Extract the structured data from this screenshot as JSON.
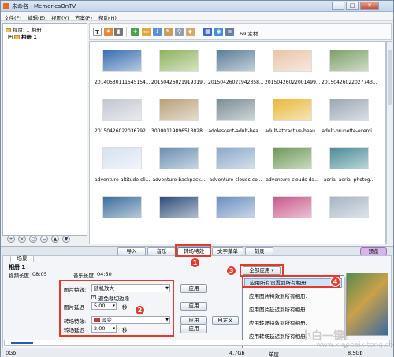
{
  "window": {
    "title": "未命名 - MemoriesOnTV",
    "controls": [
      "–",
      "□",
      "✕"
    ]
  },
  "menu": [
    "文件(F)",
    "编辑(E)",
    "视图(V)",
    "方案(P)",
    "帮助(H)"
  ],
  "tree": {
    "root": "视盘: 1 相册",
    "album": "相册 1"
  },
  "toolbar": {
    "count": "69 素材"
  },
  "photos": [
    {
      "name": "20140530111545154...",
      "color": "#3a6fb0"
    },
    {
      "name": "20150426021919319...",
      "color": "#8fb25e"
    },
    {
      "name": "20150426021942358...",
      "color": "#5c7e9a"
    },
    {
      "name": "20150426022001499...",
      "color": "#e9c4a8"
    },
    {
      "name": "20150426022027743...",
      "color": "#7ea06a"
    },
    {
      "name": "20150426022036792...",
      "color": "#c2c7cf"
    },
    {
      "name": "30000119896513028...",
      "color": "#b8a07a"
    },
    {
      "name": "adolescent-adult-bea...",
      "color": "#7a8d94"
    },
    {
      "name": "adult-attractive-beau...",
      "color": "#e8b83a"
    },
    {
      "name": "adult-brunette-exerci...",
      "color": "#9aa7b4"
    },
    {
      "name": "adventure-altitude-cli...",
      "color": "#d6e2ef"
    },
    {
      "name": "adventure-backpack...",
      "color": "#6b8fb2"
    },
    {
      "name": "adventure-clouds-co...",
      "color": "#8ba9c9"
    },
    {
      "name": "adventure-clouds-da...",
      "color": "#6f9a5a"
    },
    {
      "name": "aerial-aerial-photog...",
      "color": "#4c8c98"
    },
    {
      "name": "",
      "color": "#3e6e9c"
    },
    {
      "name": "",
      "color": "#2f4e7a"
    },
    {
      "name": "",
      "color": "#6d8fc0"
    },
    {
      "name": "",
      "color": "#c85a8a"
    },
    {
      "name": "",
      "color": "#a6b4c4"
    }
  ],
  "tabs": [
    "导入",
    "音乐",
    "转场特效",
    "文字菜单",
    "刻录"
  ],
  "preview_tab": "预览",
  "panel": {
    "tab": "场景",
    "album_title": "相册 1",
    "video_length_label": "视频长度",
    "video_length": "08:05",
    "music_length_label": "音乐长度",
    "music_length": "04:50",
    "image_effect_label": "图片特效:",
    "image_effect_value": "随机放大",
    "crop_label": "避免裁切边缘",
    "image_delay_label": "图片延迟",
    "image_delay_value": "5.00",
    "transition_label": "转场特效:",
    "transition_value": "淡变",
    "transition_delay_label": "转场延迟",
    "transition_delay_value": "2.00",
    "seconds": "秒",
    "apply": "应用",
    "custom": "自定义",
    "apply_all": "全部应用"
  },
  "popup_menu": [
    "应用所有设置到所有相册.",
    "应用图片特效到所有相册.",
    "应用图片延迟到所有相册.",
    "应用转场特效到所有相册.",
    "应用转场延迟到所有相册."
  ],
  "popup_bottom": "单层",
  "timeline": {
    "start": "0Gb",
    "mid": "4.7Gb",
    "end": "8.5Gb"
  },
  "statusbar": {
    "label": "单层"
  },
  "badges": [
    "1",
    "2",
    "3",
    "4"
  ],
  "watermark": {
    "text": "小白一键",
    "site": "www.xiaobaixitong.com"
  }
}
